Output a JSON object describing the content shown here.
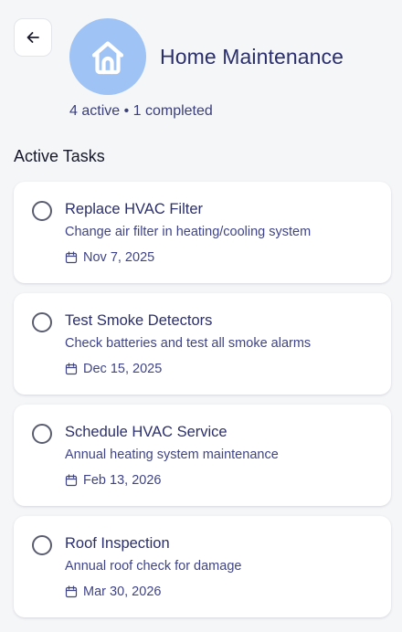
{
  "header": {
    "title": "Home Maintenance",
    "summary": "4 active • 1 completed",
    "icon": "home-icon",
    "icon_bg": "#9fc3f5"
  },
  "section": {
    "title": "Active Tasks"
  },
  "tasks": [
    {
      "title": "Replace HVAC Filter",
      "description": "Change air filter in heating/cooling system",
      "date": "Nov 7, 2025",
      "completed": false
    },
    {
      "title": "Test Smoke Detectors",
      "description": "Check batteries and test all smoke alarms",
      "date": "Dec 15, 2025",
      "completed": false
    },
    {
      "title": "Schedule HVAC Service",
      "description": "Annual heating system maintenance",
      "date": "Feb 13, 2026",
      "completed": false
    },
    {
      "title": "Roof Inspection",
      "description": "Annual roof check for damage",
      "date": "Mar 30, 2026",
      "completed": false
    }
  ],
  "colors": {
    "accent": "#2b2f6b",
    "background": "#f5f6f8",
    "card": "#ffffff"
  },
  "icons": {
    "back": "arrow-left-icon",
    "check": "circle-outline-icon",
    "date": "calendar-icon"
  }
}
